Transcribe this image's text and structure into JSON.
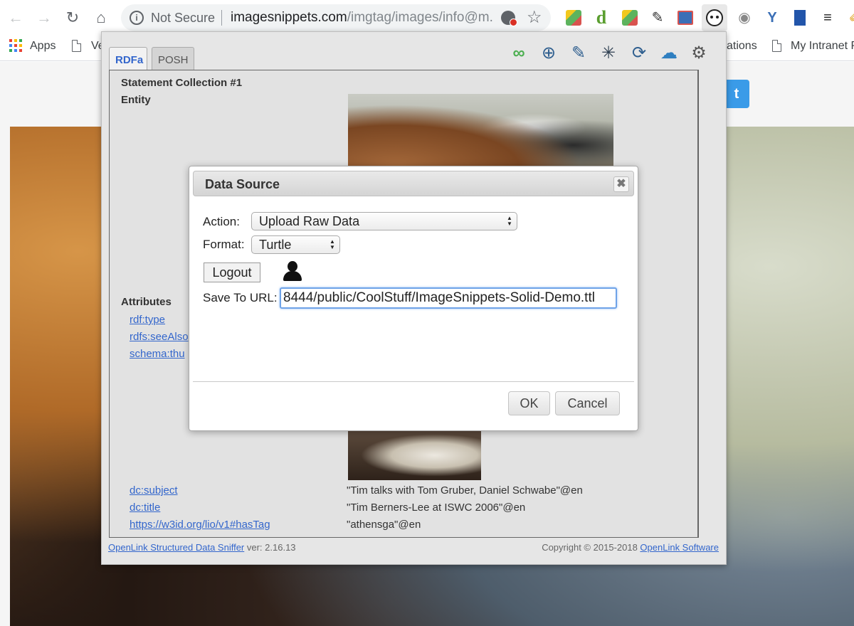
{
  "browser": {
    "security_label": "Not Secure",
    "url_host": "imagesnippets.com",
    "url_rest": "/imgtag/images/info@m...",
    "bookmarks": {
      "apps": "Apps",
      "bookmark_2": "Ve",
      "bookmark_3": "ations",
      "intranet": "My Intranet P"
    }
  },
  "sniffer": {
    "tabs": [
      {
        "label": "RDFa"
      },
      {
        "label": "POSH"
      }
    ],
    "tool_icons": [
      "link-icon",
      "globe-search-icon",
      "edit-icon",
      "graph-icon",
      "search-refresh-icon",
      "cloud-download-icon",
      "gear-icon"
    ],
    "statement_collection": "Statement Collection #1",
    "entity_label": "Entity",
    "attributes_label": "Attributes",
    "attributes": [
      {
        "name": "rdf:type",
        "value": ""
      },
      {
        "name": "rdfs:seeAlso",
        "value": ""
      },
      {
        "name": "schema:thu",
        "value": ""
      },
      {
        "name": "dc:subject",
        "value": "\"Tim talks with Tom Gruber, Daniel Schwabe\"@en"
      },
      {
        "name": "dc:title",
        "value": "\"Tim Berners-Lee at ISWC 2006\"@en"
      },
      {
        "name": "https://w3id.org/lio/v1#hasTag",
        "value": "\"athensga\"@en"
      }
    ],
    "footer": {
      "app_name": "OpenLink Structured Data Sniffer",
      "version_text": " ver: 2.16.13",
      "copyright": "Copyright © 2015-2018 ",
      "company": "OpenLink Software"
    }
  },
  "dialog": {
    "title": "Data Source",
    "close_glyph": "✖",
    "action_label": "Action:",
    "action_value": "Upload Raw Data",
    "format_label": "Format:",
    "format_value": "Turtle",
    "logout_label": "Logout",
    "save_url_label": "Save To URL:",
    "save_url_value": "8444/public/CoolStuff/ImageSnippets-Solid-Demo.ttl",
    "ok_label": "OK",
    "cancel_label": "Cancel"
  },
  "colors": {
    "accent": "#3366cc",
    "twitter": "#3a9be8",
    "focus_ring": "#6fa3e8"
  }
}
